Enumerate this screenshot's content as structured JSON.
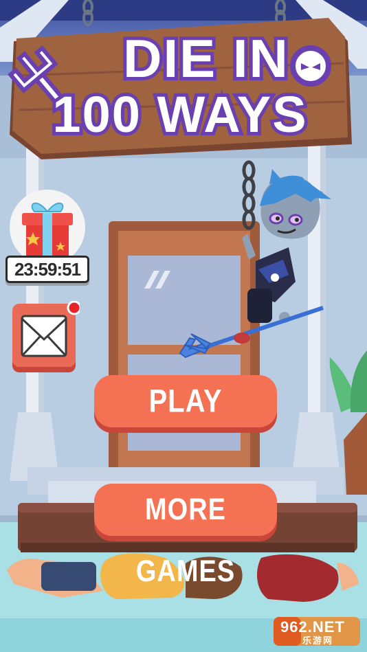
{
  "game": {
    "title_line1": "DIE IN",
    "title_line2": "100 WAYS"
  },
  "gift": {
    "timer": "23:59:51",
    "icon": "gift-box-icon"
  },
  "mail": {
    "icon": "envelope-icon",
    "has_notification": true
  },
  "buttons": {
    "play": "PLAY",
    "more_games": "MORE GAMES"
  },
  "watermark": {
    "brand": "962.NET",
    "sub": "乐游网"
  },
  "colors": {
    "button": "#f47153",
    "button_shadow": "#c8473a",
    "title_fill": "#ffffff",
    "title_outline": "#6a3fb0",
    "sign_wood": "#9a5a3c",
    "notification": "#e8232a"
  }
}
